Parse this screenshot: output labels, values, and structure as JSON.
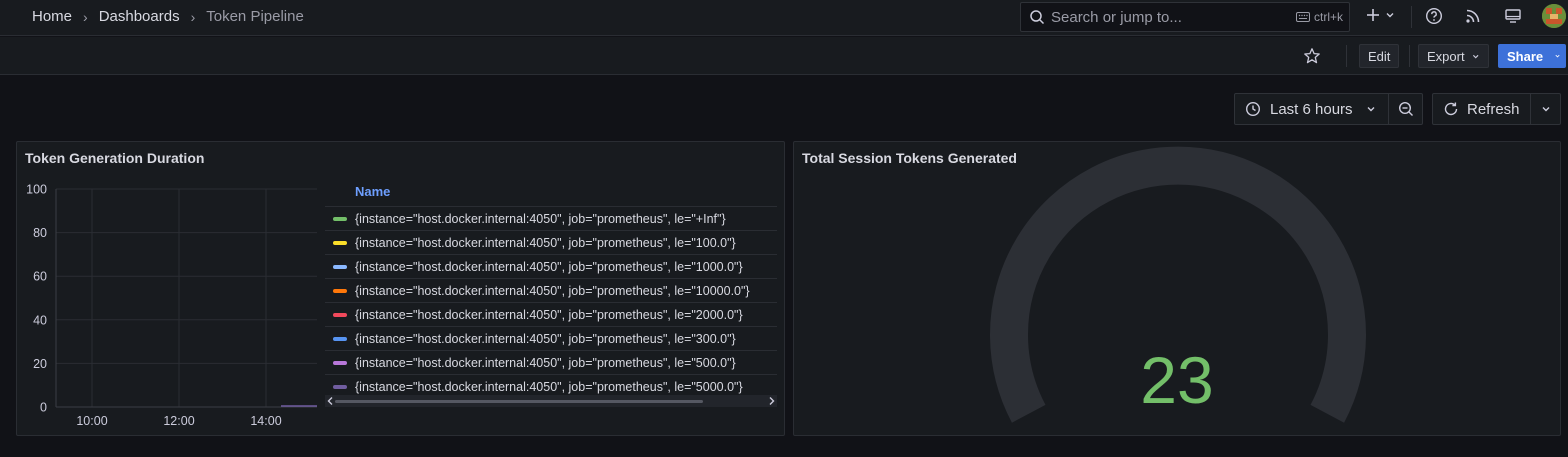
{
  "breadcrumb": {
    "home": "Home",
    "dashboards": "Dashboards",
    "current": "Token Pipeline",
    "separator": "›"
  },
  "search": {
    "placeholder": "Search or jump to...",
    "shortcut": "ctrl+k"
  },
  "toolbar": {
    "edit_label": "Edit",
    "export_label": "Export",
    "share_label": "Share"
  },
  "time_controls": {
    "range_label": "Last 6 hours",
    "refresh_label": "Refresh"
  },
  "panels": {
    "duration": {
      "title": "Token Generation Duration",
      "legend_header": "Name",
      "legend": [
        {
          "label": "{instance=\"host.docker.internal:4050\", job=\"prometheus\", le=\"+Inf\"}",
          "color": "#73bf69"
        },
        {
          "label": "{instance=\"host.docker.internal:4050\", job=\"prometheus\", le=\"100.0\"}",
          "color": "#fade2a"
        },
        {
          "label": "{instance=\"host.docker.internal:4050\", job=\"prometheus\", le=\"1000.0\"}",
          "color": "#8ab8ff"
        },
        {
          "label": "{instance=\"host.docker.internal:4050\", job=\"prometheus\", le=\"10000.0\"}",
          "color": "#ff780a"
        },
        {
          "label": "{instance=\"host.docker.internal:4050\", job=\"prometheus\", le=\"2000.0\"}",
          "color": "#f2495c"
        },
        {
          "label": "{instance=\"host.docker.internal:4050\", job=\"prometheus\", le=\"300.0\"}",
          "color": "#5794f2"
        },
        {
          "label": "{instance=\"host.docker.internal:4050\", job=\"prometheus\", le=\"500.0\"}",
          "color": "#b877d9"
        },
        {
          "label": "{instance=\"host.docker.internal:4050\", job=\"prometheus\", le=\"5000.0\"}",
          "color": "#705da0"
        }
      ]
    },
    "tokens": {
      "title": "Total Session Tokens Generated",
      "value": "23",
      "value_color": "#73bf69"
    }
  },
  "chart_data": {
    "type": "line",
    "title": "Token Generation Duration",
    "xlabel": "",
    "ylabel": "",
    "y_ticks": [
      "0",
      "20",
      "40",
      "60",
      "80",
      "100"
    ],
    "x_ticks": [
      "10:00",
      "12:00",
      "14:00"
    ],
    "ylim": [
      0,
      100
    ],
    "grid": true,
    "legend_position": "right"
  }
}
